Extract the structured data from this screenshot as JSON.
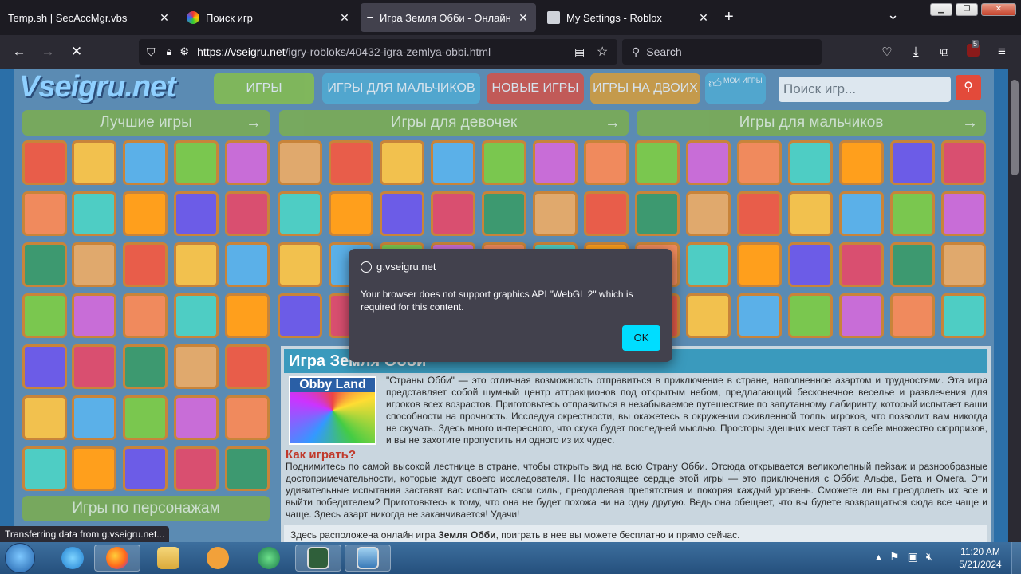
{
  "browser": {
    "tabs": [
      {
        "title": "Temp.sh | SecAccMgr.vbs",
        "close": "✕"
      },
      {
        "title": "Поиск игр",
        "close": "✕"
      },
      {
        "title": "Игра Земля Обби - Онлайн",
        "close": "✕"
      },
      {
        "title": "My Settings - Roblox",
        "close": "✕"
      }
    ],
    "new_tab": "+",
    "tab_list": "⌄",
    "url_host": "https://vseigru.net",
    "url_path": "/igry-robloks/40432-igra-zemlya-obbi.html",
    "search_placeholder": "Search",
    "extension_badge": "5"
  },
  "site": {
    "logo": "Vseigru.net",
    "menu": [
      "ИГРЫ",
      "ИГРЫ ДЛЯ МАЛЬЧИКОВ",
      "НОВЫЕ ИГРЫ",
      "ИГРЫ НА ДВОИХ",
      "МОИ ИГРЫ"
    ],
    "search_placeholder": "Поиск игр...",
    "sections": [
      "Лучшие игры",
      "Игры для девочек",
      "Игры для мальчиков"
    ],
    "section_arrow": "→",
    "sidebar_section": "Игры по персонажам",
    "colors": {
      "green": "#7eb04a",
      "orange": "#e8a02a",
      "red": "#e34a3a",
      "blue": "#3a9abd"
    }
  },
  "article": {
    "title": "Игра Земля Обби",
    "image_label": "Obby Land",
    "paragraph1": "\"Страны Обби\" — это отличная возможность отправиться в приключение в стране, наполненное азартом и трудностями. Эта игра представляет собой шумный центр аттракционов под открытым небом, предлагающий бесконечное веселье и развлечения для игроков всех возрастов. Приготовьтесь отправиться в незабываемое путешествие по запутанному лабиринту, который испытает ваши способности на прочность. Исследуя окрестности, вы окажетесь в окружении оживленной толпы игроков, что позволит вам никогда не скучать. Здесь много интересного, что скука будет последней мыслью. Просторы здешних мест таят в себе множество сюрпризов, и вы не захотите пропустить ни одного из их чудес.",
    "howto_title": "Как играть?",
    "paragraph2": "Поднимитесь по самой высокой лестнице в стране, чтобы открыть вид на всю Страну Обби. Отсюда открывается великолепный пейзаж и разнообразные достопримечательности, которые ждут своего исследователя. Но настоящее сердце этой игры — это приключения с Обби: Альфа, Бета и Омега. Эти удивительные испытания заставят вас испытать свои силы, преодолевая препятствия и покоряя каждый уровень. Сможете ли вы преодолеть их все и выйти победителем? Приготовьтесь к тому, что она не будет похожа ни на одну другую. Ведь она обещает, что вы будете возвращаться сюда все чаще и чаще. Здесь азарт никогда не заканчивается! Удачи!",
    "note_prefix": "Здесь расположена онлайн игра ",
    "note_game": "Земля Обби",
    "note_suffix": ", поиграть в нее вы можете бесплатно и прямо сейчас."
  },
  "status_text": "Transferring data from g.vseigru.net...",
  "dialog": {
    "origin": "g.vseigru.net",
    "message": "Your browser does not support graphics API \"WebGL 2\" which is required for this content.",
    "ok": "OK"
  },
  "taskbar": {
    "time": "11:20 AM",
    "date": "5/21/2024"
  }
}
